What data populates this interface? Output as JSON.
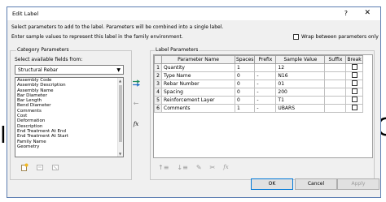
{
  "window": {
    "title": "Edit Label",
    "help": "?",
    "close": "✕"
  },
  "instructions": {
    "line1": "Select parameters to add to the label.  Parameters will be combined into a single label.",
    "line2": "Enter sample values to represent this label in the family environment."
  },
  "wrap_option": {
    "label": "Wrap between parameters only",
    "checked": false
  },
  "category_parameters": {
    "heading": "Category Parameters",
    "select_label": "Select available fields from:",
    "selected_category": "Structural Rebar",
    "fields": [
      "Assembly Code",
      "Assembly Description",
      "Assembly Name",
      "Bar Diameter",
      "Bar Length",
      "Bend Diameter",
      "Comments",
      "Cost",
      "Deformation",
      "Description",
      "End Treatment At End",
      "End Treatment At Start",
      "Family Name",
      "Geometry"
    ]
  },
  "label_parameters": {
    "heading": "Label Parameters",
    "columns": [
      "Parameter Name",
      "Spaces",
      "Prefix",
      "Sample Value",
      "Suffix",
      "Break"
    ],
    "rows": [
      {
        "num": "1",
        "name": "Quantity",
        "spaces": "1",
        "prefix": "",
        "sample": "12",
        "suffix": "",
        "break": false
      },
      {
        "num": "2",
        "name": "Type Name",
        "spaces": "0",
        "prefix": "-",
        "sample": "N16",
        "suffix": "",
        "break": false
      },
      {
        "num": "3",
        "name": "Rebar Number",
        "spaces": "0",
        "prefix": "-",
        "sample": "01",
        "suffix": "",
        "break": false
      },
      {
        "num": "4",
        "name": "Spacing",
        "spaces": "0",
        "prefix": "-",
        "sample": "200",
        "suffix": "",
        "break": false
      },
      {
        "num": "5",
        "name": "Reinforcement Layer",
        "spaces": "0",
        "prefix": "-",
        "sample": "T1",
        "suffix": "",
        "break": false
      },
      {
        "num": "6",
        "name": "Comments",
        "spaces": "1",
        "prefix": "-",
        "sample": "UBARS",
        "suffix": "",
        "break": false
      }
    ]
  },
  "buttons": {
    "ok": "OK",
    "cancel": "Cancel",
    "apply": "Apply"
  },
  "icons": {
    "add_param": "add-parameter-icon",
    "remove_param": "remove-parameter-icon",
    "fx": "fx",
    "new_param": "new-parameter-icon",
    "edit_param": "edit-parameter-icon",
    "delete_param": "delete-parameter-icon",
    "move_up": "move-up-icon",
    "move_down": "move-down-icon"
  }
}
